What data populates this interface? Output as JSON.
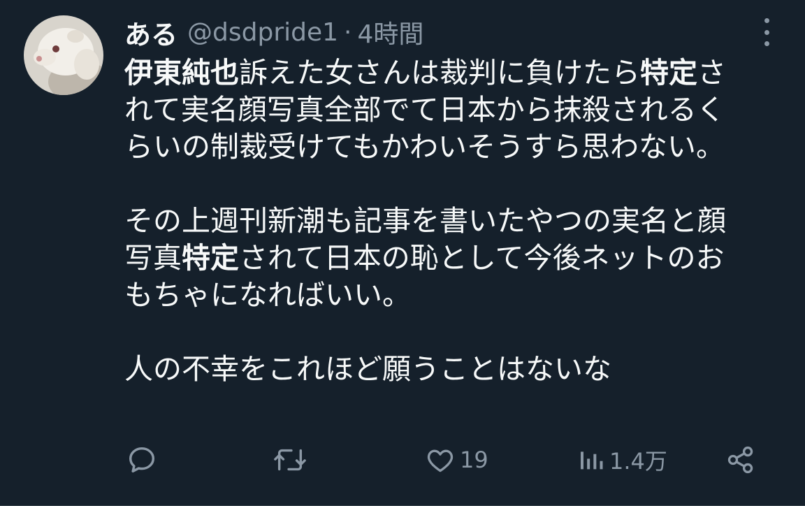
{
  "tweet": {
    "author_name": "ある",
    "handle": "@dsdpride1",
    "separator": "·",
    "time": "4時間",
    "avatar_icon": "ferret-photo-avatar",
    "more_icon": "more-vertical-icon",
    "body": {
      "p1": {
        "bold1": "伊東純也",
        "text1": "訴えた女さんは裁判に負けたら",
        "bold2": "特定",
        "text2": "さ",
        "line2": "れて実名顔写真全部でて日本から抹殺されるく",
        "line3": "らいの制裁受けてもかわいそうすら思わない。"
      },
      "p2": {
        "line1": "その上週刊新潮も記事を書いたやつの実名と顔",
        "line2a": "写真",
        "line2b": "特定",
        "line2c": "されて日本の恥として今後ネットのお",
        "line3": "もちゃになればいい。"
      },
      "p3": {
        "line1": "人の不幸をこれほど願うことはないな"
      }
    },
    "actions": {
      "reply_icon": "reply-icon",
      "retweet_icon": "retweet-icon",
      "like_icon": "heart-icon",
      "like_count": "19",
      "views_icon": "views-bar-icon",
      "views_count": "1.4万",
      "share_icon": "share-icon"
    }
  },
  "colors": {
    "background": "#15202b",
    "text_primary": "#f7f9f9",
    "text_secondary": "#8b98a5"
  }
}
